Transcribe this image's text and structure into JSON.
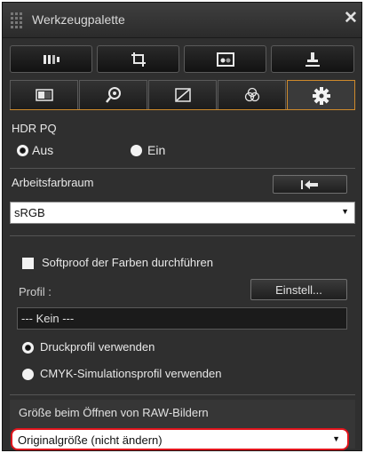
{
  "window": {
    "title": "Werkzeugpalette",
    "close_symbol": "✕"
  },
  "toolbar": {
    "buttons": [
      {
        "name": "basic-adjust-icon"
      },
      {
        "name": "crop-icon"
      },
      {
        "name": "image-icon"
      },
      {
        "name": "stamp-icon"
      }
    ]
  },
  "tabs": [
    {
      "name": "tab-tone"
    },
    {
      "name": "tab-detail"
    },
    {
      "name": "tab-curve"
    },
    {
      "name": "tab-color"
    },
    {
      "name": "tab-settings",
      "active": true
    }
  ],
  "hdr": {
    "heading": "HDR PQ",
    "options": [
      {
        "label": "Aus",
        "selected": true
      },
      {
        "label": "Ein",
        "selected": false
      }
    ]
  },
  "workspace": {
    "heading": "Arbeitsfarbraum",
    "value": "sRGB"
  },
  "softproof": {
    "checkbox_label": "Softproof der Farben durchführen",
    "checked": false,
    "profile_label": "Profil :",
    "settings_button": "Einstell...",
    "profile_value": "--- Kein ---",
    "options": [
      {
        "label": "Druckprofil verwenden",
        "selected": true
      },
      {
        "label": "CMYK-Simulationsprofil verwenden",
        "selected": false
      }
    ]
  },
  "raw_open": {
    "heading": "Größe beim Öffnen von RAW-Bildern",
    "value": "Originalgröße (nicht ändern)"
  },
  "colors": {
    "panel": "#2f2f2f",
    "active_tab_border": "#cf8a2b",
    "highlight": "#e0141c"
  }
}
